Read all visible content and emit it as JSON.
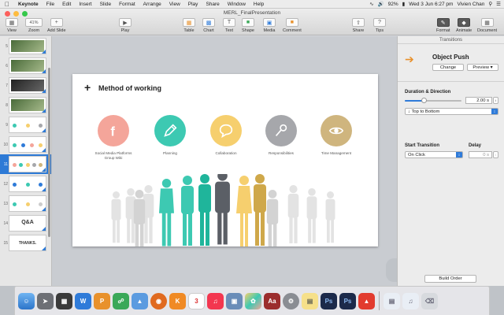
{
  "menubar": {
    "app": "Keynote",
    "items": [
      "File",
      "Edit",
      "Insert",
      "Slide",
      "Format",
      "Arrange",
      "View",
      "Play",
      "Share",
      "Window",
      "Help"
    ],
    "battery": "92%",
    "datetime": "Wed 3 Jun  6:27 pm",
    "user": "Vivien Chan"
  },
  "window": {
    "title": "MERL_FinalPresentation"
  },
  "toolbar": {
    "view": "View",
    "zoom": "Zoom",
    "zoom_value": "41%",
    "add_slide": "Add Slide",
    "play": "Play",
    "table": "Table",
    "chart": "Chart",
    "text": "Text",
    "shape": "Shape",
    "media": "Media",
    "comment": "Comment",
    "share": "Share",
    "tips": "Tips",
    "format": "Format",
    "animate": "Animate",
    "document": "Document"
  },
  "slides": {
    "numbers": [
      "5",
      "6",
      "7",
      "8",
      "9",
      "10",
      "11",
      "12",
      "13",
      "14",
      "15"
    ],
    "selected": "11",
    "qa_text": "Q&A",
    "thanks_text": "THANKS."
  },
  "slide": {
    "title": "Method of working",
    "items": [
      {
        "label": "Social Media Platforms\nGroup Wiki",
        "color": "#f4a59a",
        "glyph": "f"
      },
      {
        "label": "Planning",
        "color": "#3dc9b2",
        "glyph": "pencil"
      },
      {
        "label": "Collaboration",
        "color": "#f6cf6e",
        "glyph": "bubble"
      },
      {
        "label": "Responsibilities",
        "color": "#a6a7ab",
        "glyph": "key"
      },
      {
        "label": "Time Management",
        "color": "#cfb57e",
        "glyph": "eye"
      }
    ]
  },
  "inspector": {
    "title": "Transitions",
    "effect": "Object Push",
    "change": "Change",
    "preview": "Preview",
    "duration_label": "Duration & Direction",
    "duration_value": "2.00 s",
    "duration_fraction": 0.33,
    "direction": "Top to Bottom",
    "start_label": "Start Transition",
    "start_value": "On Click",
    "delay_label": "Delay",
    "delay_value": "0 s",
    "build_order": "Build Order"
  },
  "colors": {
    "accent": "#2d7ad6",
    "orange": "#e8912c"
  }
}
